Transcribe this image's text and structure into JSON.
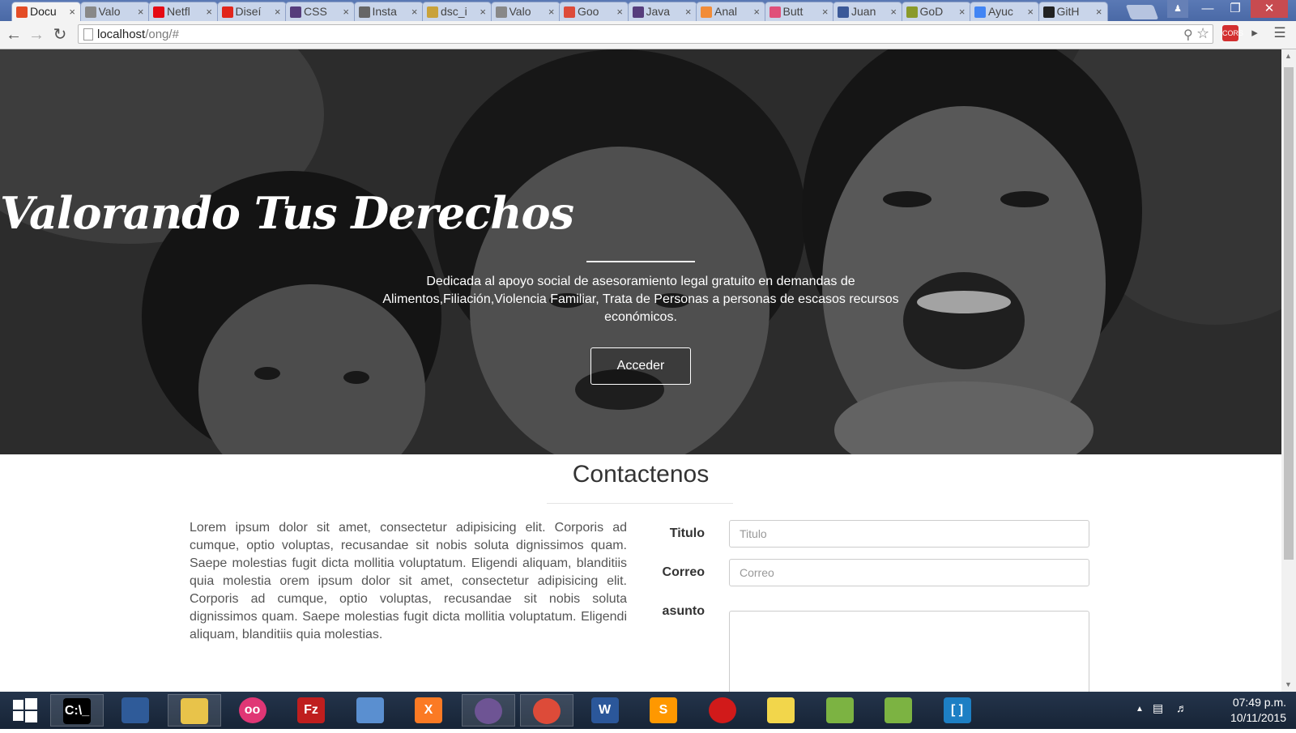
{
  "browser": {
    "tabs": [
      {
        "label": "Docu",
        "icon": "html5-icon",
        "color": "#e44d26",
        "active": true
      },
      {
        "label": "Valo",
        "icon": "page-icon",
        "color": "#888888"
      },
      {
        "label": "Netfl",
        "icon": "netflix-icon",
        "color": "#e50914"
      },
      {
        "label": "Diseí",
        "icon": "adobe-icon",
        "color": "#e1251b"
      },
      {
        "label": "CSS",
        "icon": "bootstrap-icon",
        "color": "#563d7c"
      },
      {
        "label": "Insta",
        "icon": "page-icon",
        "color": "#666666"
      },
      {
        "label": "dsc_i",
        "icon": "image-icon",
        "color": "#c9a23a"
      },
      {
        "label": "Valo",
        "icon": "page-icon",
        "color": "#888888"
      },
      {
        "label": "Goo",
        "icon": "google-icon",
        "color": "#dd4b39"
      },
      {
        "label": "Java",
        "icon": "bootstrap-icon",
        "color": "#563d7c"
      },
      {
        "label": "Anal",
        "icon": "puzzle-icon",
        "color": "#f28c38"
      },
      {
        "label": "Butt",
        "icon": "brush-icon",
        "color": "#e0507a"
      },
      {
        "label": "Juan",
        "icon": "facebook-icon",
        "color": "#3b5998"
      },
      {
        "label": "GoD",
        "icon": "godaddy-icon",
        "color": "#8a9a2a"
      },
      {
        "label": "Ayuc",
        "icon": "google-g-icon",
        "color": "#4285f4"
      },
      {
        "label": "GitH",
        "icon": "github-icon",
        "color": "#222222"
      }
    ],
    "close_glyph": "×",
    "url_host": "localhost",
    "url_path": "/ong/#",
    "ext_cors": "CORS"
  },
  "hero": {
    "title": "Valorando Tus Derechos",
    "description": "Dedicada al apoyo social de asesoramiento legal gratuito en demandas de Alimentos,Filiación,Violencia Familiar, Trata de Personas a personas de escasos recursos económicos.",
    "button_label": "Acceder"
  },
  "contact": {
    "title": "Contactenos",
    "body": "Lorem ipsum dolor sit amet, consectetur adipisicing elit. Corporis ad cumque, optio voluptas, recusandae sit nobis soluta dignissimos quam. Saepe molestias fugit dicta mollitia voluptatum. Eligendi aliquam, blanditiis quia molestia orem ipsum dolor sit amet, consectetur adipisicing elit. Corporis ad cumque, optio voluptas, recusandae sit nobis soluta dignissimos quam. Saepe molestias fugit dicta mollitia voluptatum. Eligendi aliquam, blanditiis quia molestias.",
    "form": {
      "titulo_label": "Titulo",
      "titulo_placeholder": "Titulo",
      "correo_label": "Correo",
      "correo_placeholder": "Correo",
      "asunto_label": "asunto"
    }
  },
  "taskbar": {
    "clock_time": "07:49 p.m.",
    "clock_date": "10/11/2015",
    "apps": [
      {
        "name": "start-icon",
        "label": ""
      },
      {
        "name": "terminal-icon",
        "label": "C:\\_",
        "color": "#000000"
      },
      {
        "name": "virtualbox-icon",
        "label": "",
        "color": "#2f5b99"
      },
      {
        "name": "file-explorer-icon",
        "label": "",
        "color": "#e8c34a"
      },
      {
        "name": "flickr-icon",
        "label": "oo",
        "color": "#e03675"
      },
      {
        "name": "filezilla-icon",
        "label": "Fz",
        "color": "#bf1e1e"
      },
      {
        "name": "cube-icon",
        "label": "",
        "color": "#5a8fd0"
      },
      {
        "name": "xampp-icon",
        "label": "X",
        "color": "#fb7a24"
      },
      {
        "name": "github-desktop-icon",
        "label": "",
        "color": "#6e5494"
      },
      {
        "name": "chrome-icon",
        "label": "",
        "color": "#dd4b39"
      },
      {
        "name": "word-icon",
        "label": "W",
        "color": "#2b579a"
      },
      {
        "name": "sublime-icon",
        "label": "S",
        "color": "#ff9800"
      },
      {
        "name": "record-icon",
        "label": "",
        "color": "#d11a1a"
      },
      {
        "name": "sticky-notes-icon",
        "label": "",
        "color": "#f2d64b"
      },
      {
        "name": "android-studio-icon",
        "label": "",
        "color": "#7cb342"
      },
      {
        "name": "android-studio-2-icon",
        "label": "",
        "color": "#7cb342"
      },
      {
        "name": "brackets-icon",
        "label": "[ ]",
        "color": "#1d7fc4"
      }
    ]
  }
}
